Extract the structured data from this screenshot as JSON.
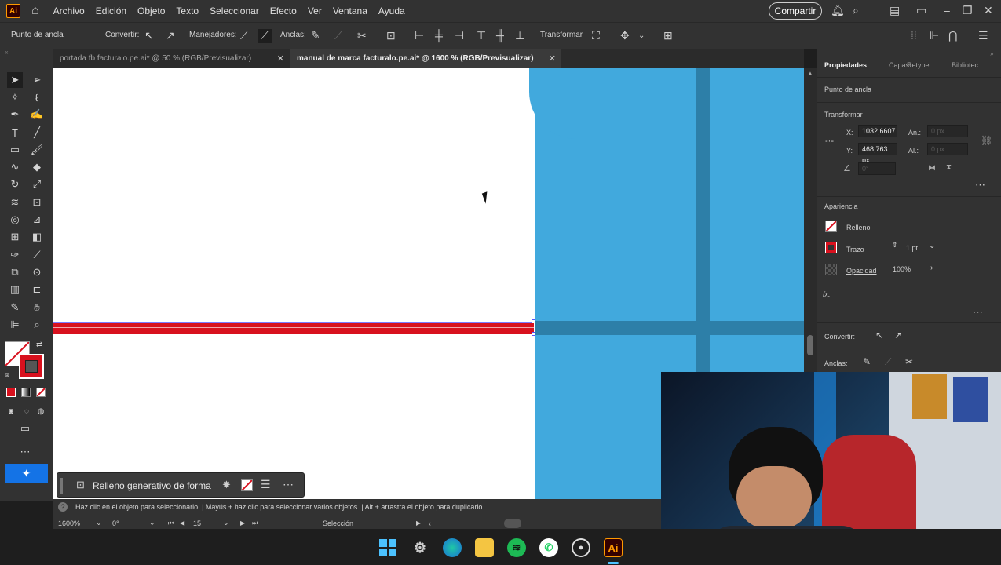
{
  "app": {
    "logo": "Ai"
  },
  "menu": {
    "items": [
      "Archivo",
      "Edición",
      "Objeto",
      "Texto",
      "Seleccionar",
      "Efecto",
      "Ver",
      "Ventana",
      "Ayuda"
    ],
    "share_label": "Compartir"
  },
  "control_bar": {
    "selection_type": "Punto de ancla",
    "convert_label": "Convertir:",
    "handles_label": "Manejadores:",
    "anchors_label": "Anclas:",
    "transform_label": "Transformar"
  },
  "tabs": [
    {
      "label": "portada fb facturalo.pe.ai* @ 50 % (RGB/Previsualizar)",
      "active": false
    },
    {
      "label": "manual de marca facturalo.pe.ai* @ 1600 % (RGB/Previsualizar)",
      "active": true
    }
  ],
  "contextual_task_bar": {
    "label": "Relleno generativo de forma"
  },
  "status": {
    "hint": "Haz clic en el objeto para seleccionarlo.  |  Mayús + haz clic para seleccionar varios objetos.  |  Alt + arrastra el objeto para duplicarlo.",
    "zoom": "1600%",
    "rotation": "0°",
    "artboard": "15",
    "tool": "Selección"
  },
  "properties_panel": {
    "tabs": [
      "Propiedades",
      "Capas",
      "Retype",
      "Bibliotec"
    ],
    "selection": "Punto de ancla",
    "transform": {
      "title": "Transformar",
      "x_label": "X:",
      "x_value": "1032,6607",
      "y_label": "Y:",
      "y_value": "468,763 px",
      "w_label": "An.:",
      "w_value": "0 px",
      "h_label": "Al.:",
      "h_value": "0 px",
      "angle_value": "0°"
    },
    "appearance": {
      "title": "Apariencia",
      "fill_label": "Relleno",
      "stroke_label": "Trazo",
      "stroke_value": "1 pt",
      "opacity_label": "Opacidad",
      "opacity_value": "100%",
      "fx_label": "fx."
    },
    "convert_label": "Convertir:",
    "anchors_label": "Anclas:"
  },
  "colors": {
    "artwork_blue": "#41a9dd",
    "artwork_blue_dark": "#2d7fa8",
    "selected_red": "#d8111e",
    "fill_stroke_active": "#d8111e"
  }
}
